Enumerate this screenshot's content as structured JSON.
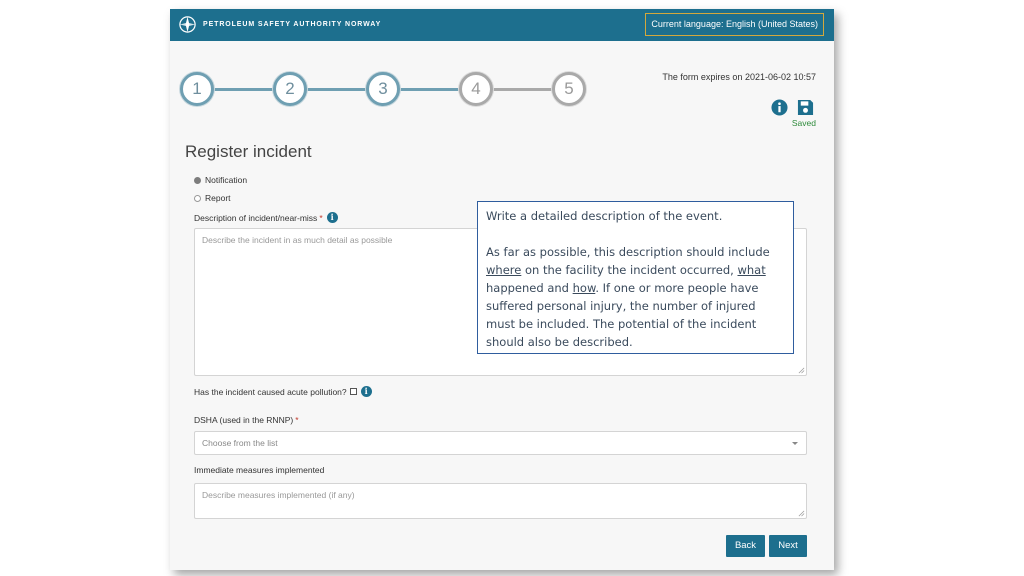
{
  "header": {
    "brand": "PETROLEUM SAFETY AUTHORITY NORWAY",
    "language_button": "Current language: English (United States)"
  },
  "stepper": {
    "steps": [
      "1",
      "2",
      "3",
      "4",
      "5"
    ],
    "active_step": 3
  },
  "form_meta": {
    "expiry": "The form expires on 2021-06-02 10:57",
    "saved_label": "Saved"
  },
  "form": {
    "title": "Register incident",
    "type_options": [
      {
        "label": "Notification",
        "checked": true
      },
      {
        "label": "Report",
        "checked": false
      }
    ],
    "description": {
      "label": "Description of incident/near-miss",
      "required_mark": "*",
      "placeholder": "Describe the incident in as much detail as possible"
    },
    "pollution": {
      "label": "Has the incident caused acute pollution?"
    },
    "dsha": {
      "label": "DSHA (used in the RNNP)",
      "required_mark": "*",
      "placeholder": "Choose from the list"
    },
    "measures": {
      "label": "Immediate measures implemented",
      "placeholder": "Describe measures implemented (if any)"
    },
    "buttons": {
      "back": "Back",
      "next": "Next"
    }
  },
  "tooltip": {
    "line1": "Write a detailed description of the event.",
    "p2_a": "As far as possible, this description should include ",
    "p2_where": "where",
    "p2_b": " on the facility the incident occurred, ",
    "p2_what": "what",
    "p2_c": " happened and ",
    "p2_how": "how",
    "p2_d": ". If one or more people have suffered personal injury, the number of injured must be included. The potential of the incident should also be described."
  },
  "colors": {
    "brand": "#1d6f8e",
    "saved": "#2e8b3b",
    "required": "#c0392b",
    "step_done": "#6f9fb2",
    "step_todo": "#a9a9a9"
  },
  "icons": {
    "logo": "compass-logo-icon",
    "info": "info-icon",
    "save": "floppy-disk-icon"
  }
}
